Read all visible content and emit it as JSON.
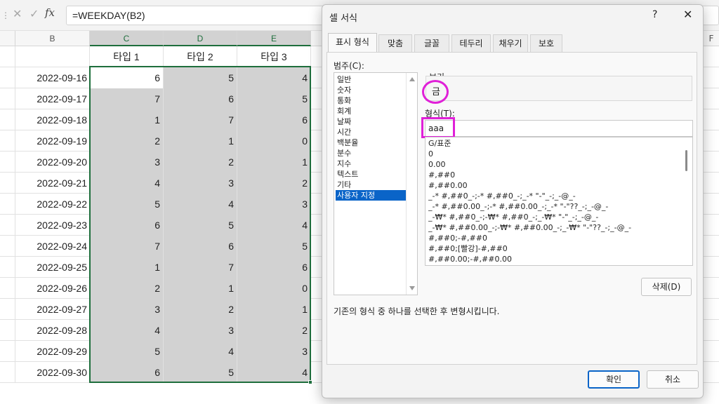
{
  "formula_bar": {
    "cancel_icon": "close-icon",
    "enter_icon": "check-icon",
    "fx_label": "fx",
    "formula": "=WEEKDAY(B2)"
  },
  "sheet": {
    "columns": [
      "B",
      "C",
      "D",
      "E",
      "F"
    ],
    "selected_columns": [
      "C",
      "D",
      "E"
    ],
    "headers": [
      "타입 1",
      "타입 2",
      "타입 3"
    ],
    "rows": [
      {
        "date": "2022-09-16",
        "t1": "6",
        "t2": "5",
        "t3": "4"
      },
      {
        "date": "2022-09-17",
        "t1": "7",
        "t2": "6",
        "t3": "5"
      },
      {
        "date": "2022-09-18",
        "t1": "1",
        "t2": "7",
        "t3": "6"
      },
      {
        "date": "2022-09-19",
        "t1": "2",
        "t2": "1",
        "t3": "0"
      },
      {
        "date": "2022-09-20",
        "t1": "3",
        "t2": "2",
        "t3": "1"
      },
      {
        "date": "2022-09-21",
        "t1": "4",
        "t2": "3",
        "t3": "2"
      },
      {
        "date": "2022-09-22",
        "t1": "5",
        "t2": "4",
        "t3": "3"
      },
      {
        "date": "2022-09-23",
        "t1": "6",
        "t2": "5",
        "t3": "4"
      },
      {
        "date": "2022-09-24",
        "t1": "7",
        "t2": "6",
        "t3": "5"
      },
      {
        "date": "2022-09-25",
        "t1": "1",
        "t2": "7",
        "t3": "6"
      },
      {
        "date": "2022-09-26",
        "t1": "2",
        "t2": "1",
        "t3": "0"
      },
      {
        "date": "2022-09-27",
        "t1": "3",
        "t2": "2",
        "t3": "1"
      },
      {
        "date": "2022-09-28",
        "t1": "4",
        "t2": "3",
        "t3": "2"
      },
      {
        "date": "2022-09-29",
        "t1": "5",
        "t2": "4",
        "t3": "3"
      },
      {
        "date": "2022-09-30",
        "t1": "6",
        "t2": "5",
        "t3": "4"
      }
    ],
    "selection_color": "#1e6e3c"
  },
  "dialog": {
    "title": "셀 서식",
    "help_label": "?",
    "close_label": "✕",
    "tabs": [
      "표시 형식",
      "맞춤",
      "글꼴",
      "테두리",
      "채우기",
      "보호"
    ],
    "active_tab": "표시 형식",
    "category_label": "범주(C):",
    "categories": [
      "일반",
      "숫자",
      "통화",
      "회계",
      "날짜",
      "시간",
      "백분율",
      "분수",
      "지수",
      "텍스트",
      "기타",
      "사용자 지정"
    ],
    "selected_category": "사용자 지정",
    "sample_label": "보기",
    "sample_value": "금",
    "type_label": "형식(T):",
    "type_value": "aaa",
    "formats": [
      "G/표준",
      "0",
      "0.00",
      "#,##0",
      "#,##0.00",
      "_-* #,##0_-;-* #,##0_-;_-* \"-\"_-;_-@_-",
      "_-* #,##0.00_-;-* #,##0.00_-;_-* \"-\"??_-;_-@_-",
      "_-₩* #,##0_-;-₩* #,##0_-;_-₩* \"-\"_-;_-@_-",
      "_-₩* #,##0.00_-;-₩* #,##0.00_-;_-₩* \"-\"??_-;_-@_-",
      "#,##0;-#,##0",
      "#,##0;[빨강]-#,##0",
      "#,##0.00;-#,##0.00"
    ],
    "delete_label": "삭제(D)",
    "description": "기존의 형식 중 하나를 선택한 후 변형시킵니다.",
    "ok_label": "확인",
    "cancel_label": "취소",
    "highlight_color": "#e020d8",
    "accent_color": "#0a64c8"
  }
}
